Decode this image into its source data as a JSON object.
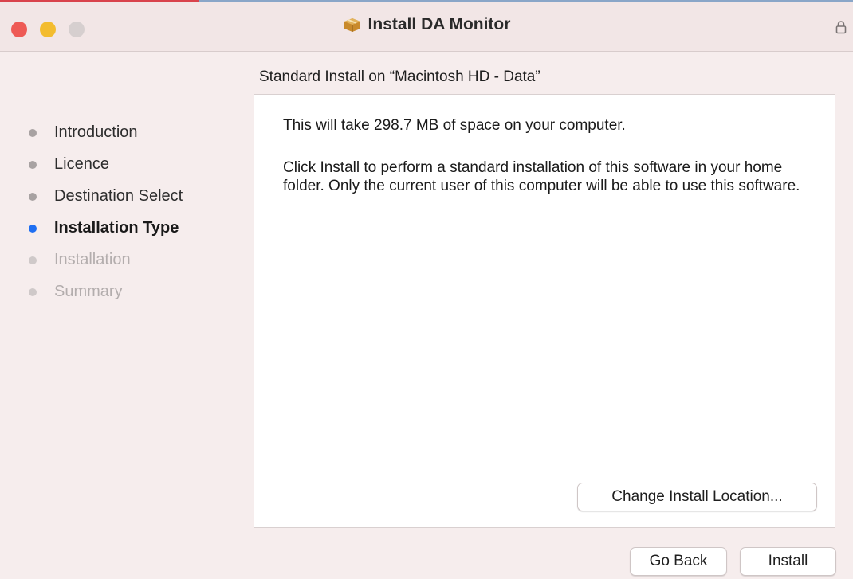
{
  "window": {
    "title": "Install DA Monitor",
    "icons": {
      "app": "package-icon",
      "lock": "lock-icon"
    }
  },
  "sidebar": {
    "steps": [
      {
        "label": "Introduction",
        "state": "done"
      },
      {
        "label": "Licence",
        "state": "done"
      },
      {
        "label": "Destination Select",
        "state": "done"
      },
      {
        "label": "Installation Type",
        "state": "current"
      },
      {
        "label": "Installation",
        "state": "future"
      },
      {
        "label": "Summary",
        "state": "future"
      }
    ]
  },
  "main": {
    "section_title": "Standard Install on “Macintosh HD - Data”",
    "space_text": "This will take 298.7 MB of space on your computer.",
    "description": "Click Install to perform a standard installation of this software in your home folder. Only the current user of this computer will be able to use this software.",
    "change_location_label": "Change Install Location..."
  },
  "footer": {
    "go_back_label": "Go Back",
    "install_label": "Install"
  },
  "colors": {
    "accent": "#1f6ff2",
    "close": "#ee5a55",
    "minimize": "#f3bc2f",
    "zoom": "#d6cfcf"
  }
}
